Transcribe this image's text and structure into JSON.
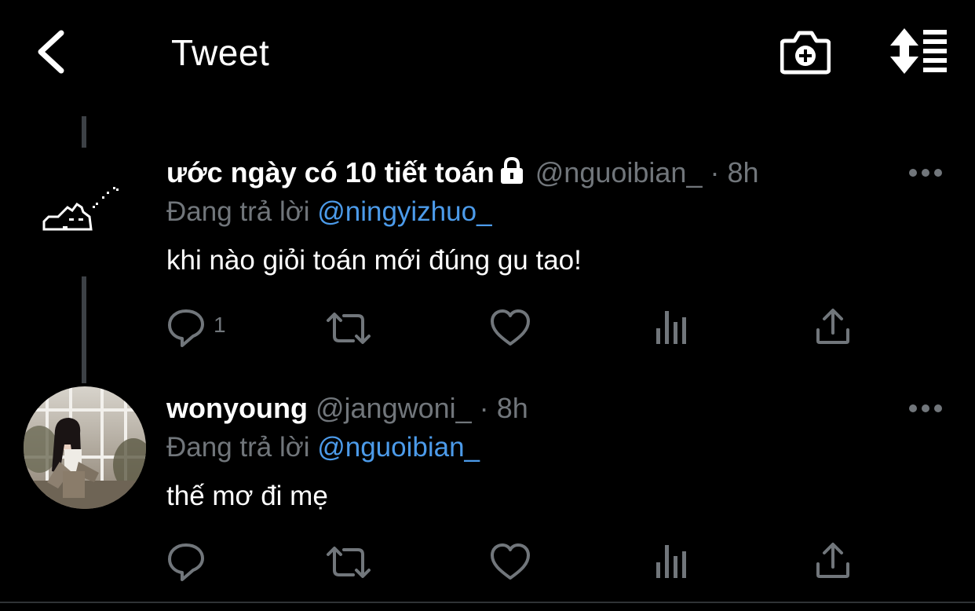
{
  "header": {
    "title": "Tweet",
    "back_icon": "chevron-left-icon",
    "camera_icon": "camera-plus-icon",
    "sort_icon": "sort-list-icon"
  },
  "tweets": [
    {
      "display_name": "ước ngày có 10 tiết toán",
      "protected": true,
      "handle": "@nguoibian_",
      "separator": "·",
      "time": "8h",
      "reply_prefix": "Đang trả lời",
      "reply_to": "@ningyizhuo_",
      "text": "khi nào giỏi toán mới đúng gu tao!",
      "reply_count": "1"
    },
    {
      "display_name": "wonyoung",
      "protected": false,
      "handle": "@jangwoni_",
      "separator": "·",
      "time": "8h",
      "reply_prefix": "Đang trả lời",
      "reply_to": "@nguoibian_",
      "text": "thế mơ đi mẹ",
      "reply_count": ""
    }
  ],
  "colors": {
    "background": "#000000",
    "secondary_text": "#71767b",
    "link": "#4c9bea",
    "thread_line": "#3d4146"
  }
}
